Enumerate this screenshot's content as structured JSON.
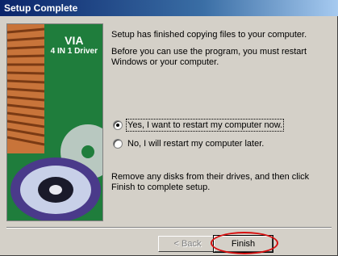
{
  "window": {
    "title": "Setup Complete"
  },
  "banner": {
    "brand_line1": "VIA",
    "brand_line2": "4 IN 1 Driver"
  },
  "messages": {
    "finished": "Setup has finished copying files to your computer.",
    "restart_notice": "Before you can use the program, you must restart Windows or your computer.",
    "remove_disks": "Remove any disks from their drives, and then click Finish to complete setup."
  },
  "options": [
    {
      "label": "Yes, I want to restart my computer now.",
      "selected": true
    },
    {
      "label": "No, I will restart my computer later.",
      "selected": false
    }
  ],
  "buttons": {
    "back": "< Back",
    "finish": "Finish"
  },
  "colors": {
    "titlebar": "#0a246a",
    "banner": "#1a7a3a",
    "highlight": "#d81010"
  }
}
